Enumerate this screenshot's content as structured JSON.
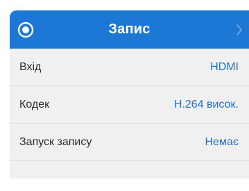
{
  "header": {
    "title": "Запис",
    "accent_color": "#1c78d4",
    "left_icon": "record-icon",
    "right_icon": "chevron-right-icon"
  },
  "settings": {
    "rows": [
      {
        "label": "Вхід",
        "value": "HDMI"
      },
      {
        "label": "Кодек",
        "value": "H.264 висок."
      },
      {
        "label": "Запуск запису",
        "value": "Немає"
      }
    ]
  }
}
